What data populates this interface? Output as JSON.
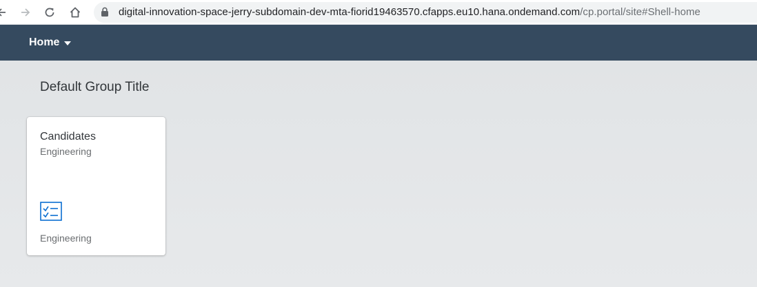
{
  "browser": {
    "url_host": "digital-innovation-space-jerry-subdomain-dev-mta-fiorid19463570.cfapps.eu10.hana.ondemand.com",
    "url_path": "/cp.portal/site#Shell-home"
  },
  "shell": {
    "menu_label": "Home"
  },
  "content": {
    "group_title": "Default Group Title",
    "tiles": [
      {
        "title": "Candidates",
        "subtitle": "Engineering",
        "icon": "task-list-icon",
        "footer": "Engineering"
      }
    ]
  },
  "colors": {
    "shell_bar": "#354a5f",
    "content_bg": "#e6e8ea",
    "tile_icon": "#0a6ed1"
  }
}
